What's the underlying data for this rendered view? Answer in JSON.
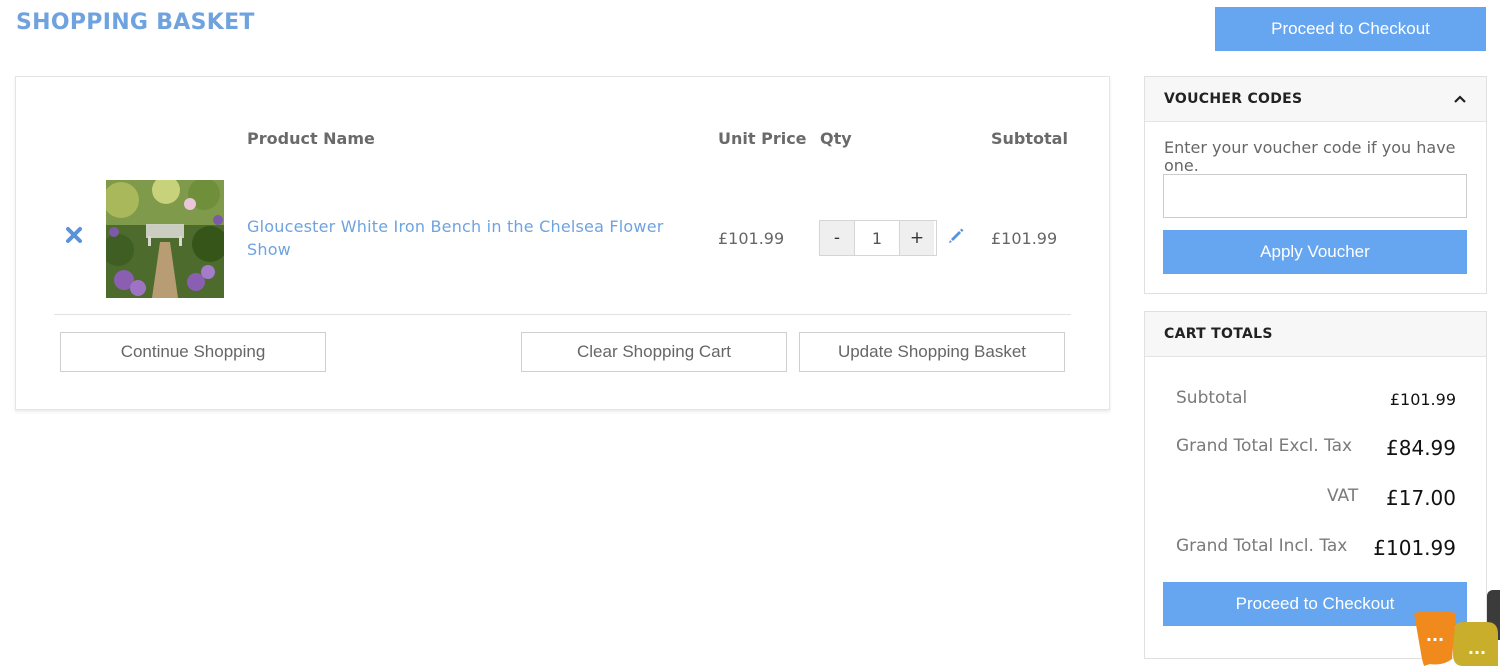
{
  "header": {
    "title": "SHOPPING BASKET",
    "proceed_label": "Proceed to Checkout"
  },
  "cart": {
    "columns": {
      "product_name": "Product Name",
      "unit_price": "Unit Price",
      "qty": "Qty",
      "subtotal": "Subtotal"
    },
    "items": [
      {
        "name": "Gloucester White Iron Bench in the Chelsea Flower Show",
        "unit_price": "£101.99",
        "qty": "1",
        "subtotal": "£101.99"
      }
    ],
    "qty_minus": "-",
    "qty_plus": "+",
    "buttons": {
      "continue": "Continue Shopping",
      "clear": "Clear Shopping Cart",
      "update": "Update Shopping Basket"
    }
  },
  "voucher": {
    "heading": "VOUCHER CODES",
    "prompt": "Enter your voucher code if you have one.",
    "input_value": "",
    "apply_label": "Apply Voucher"
  },
  "totals": {
    "heading": "CART TOTALS",
    "subtotal_label": "Subtotal",
    "subtotal_value": "£101.99",
    "excl_label": "Grand Total Excl. Tax",
    "excl_value": "£84.99",
    "vat_label": "VAT",
    "vat_value": "£17.00",
    "incl_label": "Grand Total Incl. Tax",
    "incl_value": "£101.99",
    "checkout_label": "Proceed to Checkout"
  },
  "colors": {
    "accent": "#66a6f0",
    "title": "#6fa3df",
    "chat_orange": "#f08a1c",
    "chat_yellow": "#c9ae2c"
  },
  "chat": {
    "dots": "..."
  }
}
